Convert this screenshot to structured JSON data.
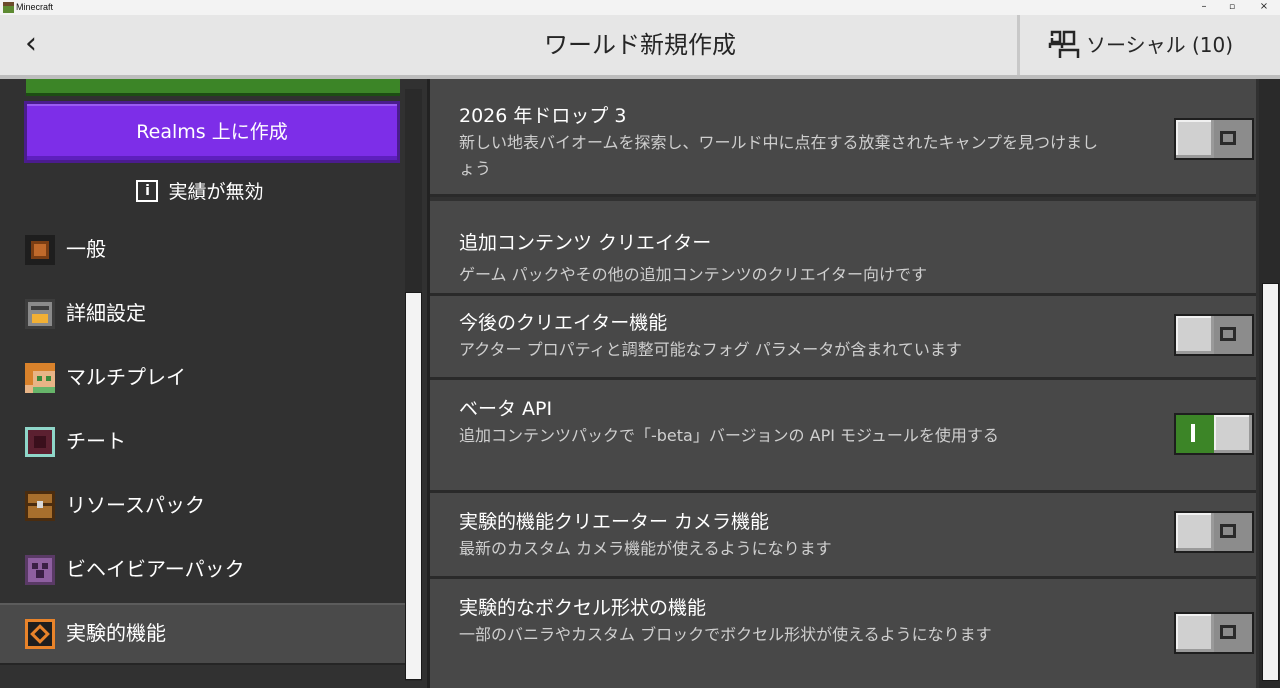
{
  "window": {
    "title": "Minecraft",
    "controls": {
      "minimize": "–",
      "maximize": "▫",
      "close": "×"
    }
  },
  "header": {
    "back_icon": "‹",
    "title": "ワールド新規作成",
    "social_label": "ソーシャル (10)"
  },
  "sidebar": {
    "realms_button": "Realms 上に作成",
    "achievements_label": "実績が無効",
    "achievements_icon": "i",
    "items": [
      {
        "label": "一般",
        "icon": "general-icon"
      },
      {
        "label": "詳細設定",
        "icon": "furnace-icon"
      },
      {
        "label": "マルチプレイ",
        "icon": "alex-head-icon"
      },
      {
        "label": "チート",
        "icon": "command-block-icon"
      },
      {
        "label": "リソースパック",
        "icon": "chest-icon"
      },
      {
        "label": "ビヘイビアーパック",
        "icon": "creeper-icon"
      },
      {
        "label": "実験的機能",
        "icon": "experiment-icon",
        "active": true
      }
    ]
  },
  "experiments": [
    {
      "title": "2026 年ドロップ 3",
      "description": "新しい地表バイオームを探索し、ワールド中に点在する放棄されたキャンプを見つけましょう",
      "enabled": false
    },
    {
      "section_title": "追加コンテンツ クリエイター",
      "section_description": "ゲーム パックやその他の追加コンテンツのクリエイター向けです"
    },
    {
      "title": "今後のクリエイター機能",
      "description": "アクター プロパティと調整可能なフォグ パラメータが含まれています",
      "enabled": false
    },
    {
      "title": "ベータ API",
      "description": "追加コンテンツパックで「-beta」バージョンの API モジュールを使用する",
      "enabled": true
    },
    {
      "title": "実験的機能クリエーター カメラ機能",
      "description": "最新のカスタム カメラ機能が使えるようになります",
      "enabled": false
    },
    {
      "title": "実験的なボクセル形状の機能",
      "description": "一部のバニラやカスタム ブロックでボクセル形状が使えるようになります",
      "enabled": false
    }
  ],
  "colors": {
    "accent_green": "#3c8527",
    "realms_purple": "#7d2ee8",
    "panel_bg": "#313131",
    "card_bg": "#484848"
  }
}
